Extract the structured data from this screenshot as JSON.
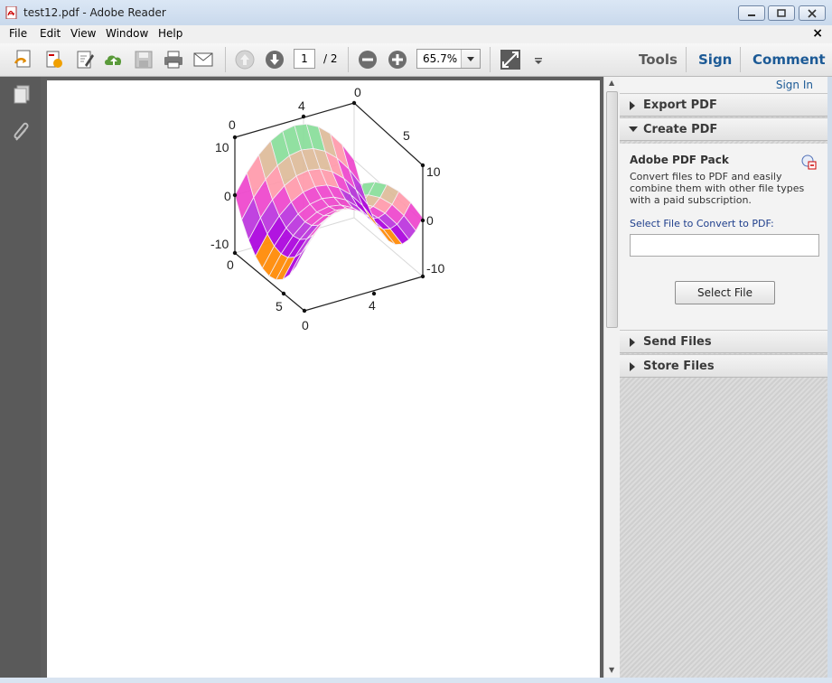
{
  "window": {
    "title": "test12.pdf - Adobe Reader"
  },
  "menu": {
    "items": [
      "File",
      "Edit",
      "View",
      "Window",
      "Help"
    ],
    "close_doc": "×"
  },
  "toolbar": {
    "page_current": "1",
    "page_total": "/ 2",
    "zoom": "65.7%",
    "links": [
      "Tools",
      "Sign",
      "Comment"
    ]
  },
  "right_panel": {
    "sign_in": "Sign In",
    "sections": {
      "export_pdf": "Export PDF",
      "create_pdf": "Create PDF",
      "send_files": "Send Files",
      "store_files": "Store Files"
    },
    "create": {
      "heading": "Adobe PDF Pack",
      "description": "Convert files to PDF and easily combine them with other file types with a paid subscription.",
      "select_label": "Select File to Convert to PDF:",
      "file_value": "",
      "select_button": "Select File"
    }
  },
  "chart_data": {
    "type": "surface3d",
    "x_ticks": [
      "0",
      "5"
    ],
    "y_ticks": [
      "0",
      "4"
    ],
    "z_ticks": [
      "-10",
      "0",
      "10"
    ],
    "surface": "saddle",
    "colors": [
      "#00ee77",
      "#88dd99",
      "#ddbb99",
      "#ff99aa",
      "#ee44cc",
      "#bb33dd",
      "#aa00dd",
      "#ff8800",
      "#888800"
    ]
  }
}
